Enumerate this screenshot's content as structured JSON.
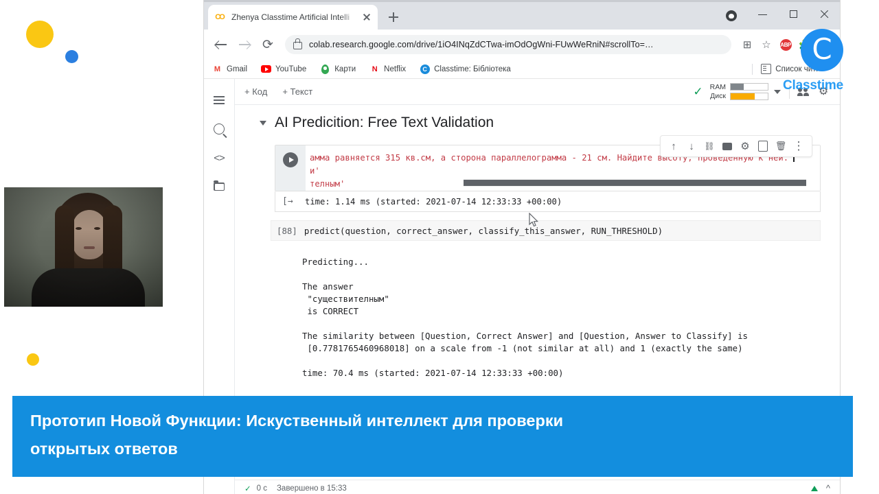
{
  "slide": {
    "caption_line1": "Прототип Новой Функции: Искуственный интеллект для проверки",
    "caption_line2": "открытых ответов",
    "brand_word": "Classtime",
    "brand_glyph": "C",
    "accent_blue": "#138ede",
    "dot_yellow": "#fac713",
    "dot_blue": "#2b7fe0"
  },
  "browser": {
    "tab": {
      "title": "Zhenya Classtime Artificial Intelli",
      "favicon": "colab-icon",
      "close": "close-icon"
    },
    "new_tab": "+",
    "window_controls": {
      "minimize": "–",
      "maximize": "□",
      "close": "✕"
    },
    "nav": {
      "back": "back-arrow-icon",
      "forward": "forward-arrow-icon",
      "reload": "⟳"
    },
    "omnibox": {
      "url": "colab.research.google.com/drive/1iO4INqZdCTwa-imOdOgWni-FUwWeRniN#scrollTo=…",
      "lock": "lock-icon",
      "install": "install-app-icon",
      "bookmark_star": "☆"
    },
    "bookmarks": [
      {
        "label": "Gmail",
        "icon": "gmail-icon"
      },
      {
        "label": "YouTube",
        "icon": "youtube-icon"
      },
      {
        "label": "Карти",
        "icon": "maps-icon"
      },
      {
        "label": "Netflix",
        "icon": "netflix-icon"
      },
      {
        "label": "Classtime: Бібліотека",
        "icon": "classtime-icon"
      }
    ],
    "reading_list": "Список читі"
  },
  "colab": {
    "sidebar": [
      {
        "name": "table-of-contents",
        "icon": "toc-icon"
      },
      {
        "name": "find-and-replace",
        "icon": "search-icon"
      },
      {
        "name": "code-snippets",
        "icon": "code-icon"
      },
      {
        "name": "files",
        "icon": "folder-icon"
      }
    ],
    "toolbar": {
      "add_code": "+ Код",
      "add_text": "+ Текст",
      "status_check": "✓",
      "ram_label": "RAM",
      "disk_label": "Диск",
      "ram_percent": 35,
      "disk_percent": 65,
      "ram_color": "#80868b",
      "disk_color": "#f9ab00",
      "dropdown": "chevron-down-icon",
      "share": "people-icon",
      "settings": "gear-icon"
    },
    "section_title": "AI Predicition: Free Text Validation",
    "cell_toolbar": [
      "move-cell-up-icon",
      "move-cell-down-icon",
      "link-to-cell-icon",
      "add-comment-icon",
      "cell-settings-icon",
      "copy-to-drive-icon",
      "delete-cell-icon",
      "more-options-icon"
    ],
    "code_cell": {
      "run_button": "run-cell-icon",
      "line1": "амма равняется 315 кв.см, а сторона параллелограмма - 21 см. Найдите высоту, проведенную к ней.'",
      "line2": "и'",
      "line3": "телным'"
    },
    "exec_output": {
      "arrow": "output-arrow-icon",
      "text": "time: 1.14 ms (started: 2021-07-14 12:33:33 +00:00)"
    },
    "second_cell": {
      "prompt": "[88]",
      "source": "predict(question, correct_answer, classify_this_answer, RUN_THRESHOLD)"
    },
    "stdout": {
      "l1": "Predicting...",
      "l2": "The answer",
      "l3": " \"существителным\"",
      "l4": " is CORRECT",
      "l5": "The similarity between [Question, Correct Answer] and [Question, Answer to Classify] is",
      "l6": " [0.7781765460968018] on a scale from -1 (not similar at all) and 1 (exactly the same)",
      "l7": "time: 70.4 ms (started: 2021-07-14 12:33:33 +00:00)"
    },
    "statusbar": {
      "check": "✓",
      "duration": "0 с",
      "completed": "Завершено в 15:33"
    }
  }
}
